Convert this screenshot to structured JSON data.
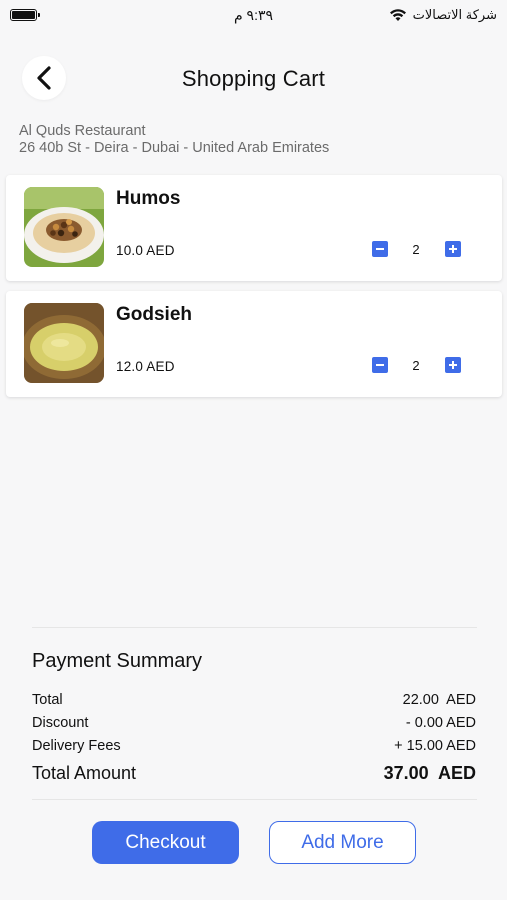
{
  "status_bar": {
    "time": "٩:٣٩ م",
    "carrier": "شركة الاتصالات"
  },
  "header": {
    "title": "Shopping Cart"
  },
  "restaurant": {
    "name": "Al Quds Restaurant",
    "address": "26 40b St - Deira - Dubai - United Arab Emirates"
  },
  "cart_items": [
    {
      "name": "Humos",
      "price": "10.0  AED",
      "quantity": "2"
    },
    {
      "name": "Godsieh",
      "price": "12.0  AED",
      "quantity": "2"
    }
  ],
  "payment_summary": {
    "title": "Payment Summary",
    "total_label": "Total",
    "total_value": "22.00  AED",
    "discount_label": "Discount",
    "discount_value": "- 0.00 AED",
    "delivery_label": "Delivery Fees",
    "delivery_value": "+ 15.00 AED",
    "grand_total_label": "Total Amount",
    "grand_total_value": "37.00  AED"
  },
  "actions": {
    "checkout_label": "Checkout",
    "add_more_label": "Add More"
  },
  "colors": {
    "accent": "#3f6ce8",
    "background": "#f7f7f8"
  }
}
